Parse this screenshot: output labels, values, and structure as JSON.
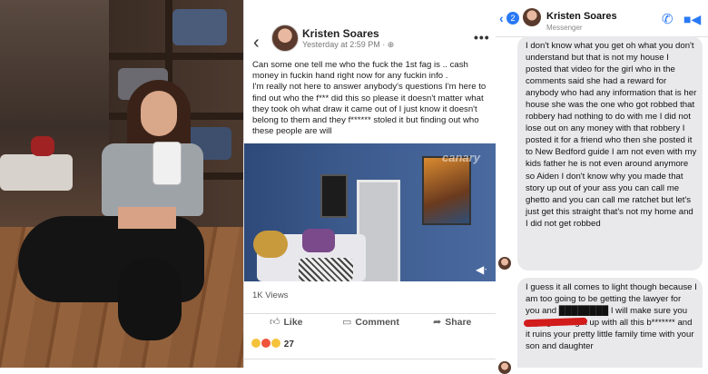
{
  "photo": {
    "alt": "selfie-photo"
  },
  "post": {
    "author": "Kristen Soares",
    "timestamp": "Yesterday at 2:59 PM · ",
    "privacy_icon": "globe-icon",
    "more_label": "•••",
    "back_label": "‹",
    "text": "Can some one tell me who the fuck the 1st fag is .. cash money in fuckin hand right  now for any fuckin info .\nI'm really not here to answer anybody's questions I'm here to find out who the f*** did this so please it doesn't matter what they took oh what draw it came out of I just know it doesn't belong to them and they f****** stoled it but finding out who these people are will",
    "video_watermark": "canary",
    "video_mute": "◀ᐧ",
    "views": "1K Views",
    "actions": {
      "like": "Like",
      "comment": "Comment",
      "share": "Share"
    },
    "reaction_count": "27",
    "reaction_colors": [
      "#f5c33b",
      "#f0533c",
      "#f5c33b"
    ]
  },
  "messenger": {
    "back_label": "‹",
    "unread_count": "2",
    "contact_name": "Kristen Soares",
    "contact_sub": "Messenger",
    "accent": "#2979f5",
    "messages": [
      {
        "text": "I don't know what you get oh what you don't understand but that is not my house I posted that video for the girl who in the comments said she had a reward for anybody who had any information that is her house she was the one who got robbed that robbery had nothing to do with me I did not lose out on any money with that robbery I posted it for a friend who then she posted it to New Bedford guide I am not even with my kids father he is not even around anymore so Aiden I don't know why you made that story up out of your ass you can call me ghetto and you can call me ratchet but let's just get this straight that's not my home and I did not get robbed"
      },
      {
        "text": "I guess it all comes to light though because I am too going to be getting the lawyer for you and ████████ I will make sure you guys get caught up with all this b******* and it ruins your pretty little family time with your son and daughter"
      }
    ]
  }
}
